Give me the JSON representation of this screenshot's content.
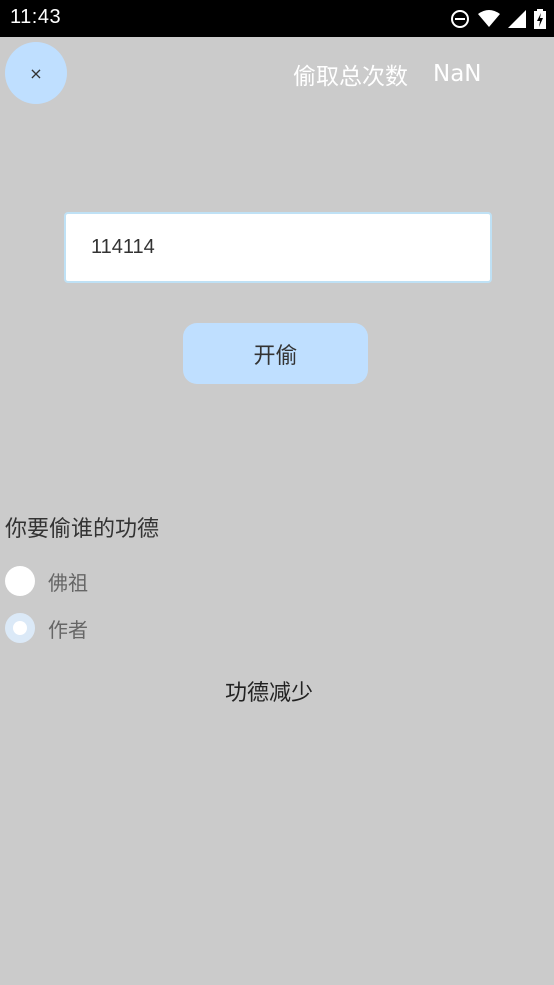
{
  "status_bar": {
    "time": "11:43",
    "icons": [
      "do-not-disturb-icon",
      "wifi-icon",
      "signal-icon",
      "battery-charging-icon"
    ]
  },
  "header": {
    "close_label": "×",
    "counter_label": "偷取总次数",
    "counter_value": "NaN"
  },
  "form": {
    "input_value": "114114",
    "start_button_label": "开偷"
  },
  "target": {
    "question": "你要偷谁的功德",
    "options": [
      {
        "label": "佛祖",
        "selected": false
      },
      {
        "label": "作者",
        "selected": true
      }
    ]
  },
  "result": {
    "text": "功德减少"
  },
  "colors": {
    "background": "#cbcbcb",
    "accent": "#bfdfff",
    "status_bar": "#000000"
  }
}
